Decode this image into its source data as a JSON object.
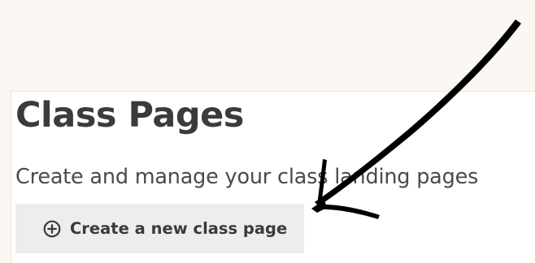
{
  "header": {
    "title": "Class Pages",
    "subtitle": "Create and manage your class landing pages"
  },
  "actions": {
    "create_label": "Create a new class page",
    "create_icon": "plus-circle-icon"
  },
  "annotation": {
    "type": "hand-drawn-arrow",
    "color": "#000000",
    "points_to": "create-class-page-button"
  },
  "colors": {
    "page_background": "#fbf7f2",
    "panel_background": "#ffffff",
    "button_background": "#ededed",
    "text": "#3b3b3b"
  }
}
